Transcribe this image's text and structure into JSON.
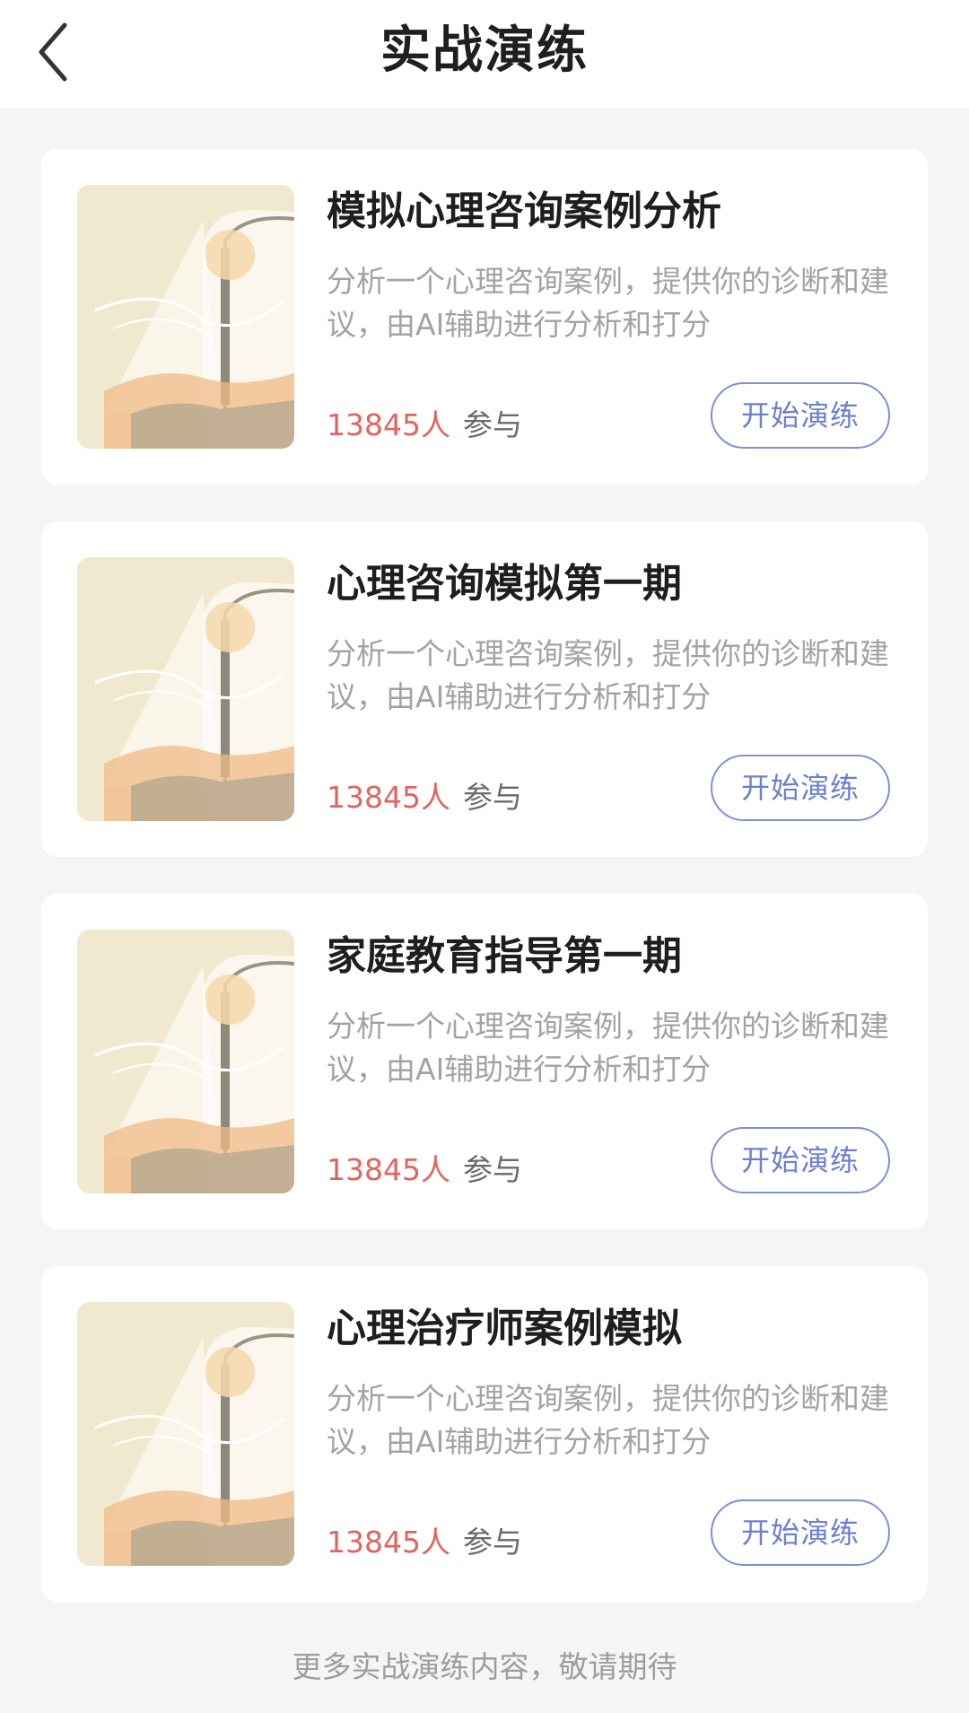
{
  "header": {
    "title": "实战演练",
    "back_icon": "chevron-left-icon"
  },
  "cards": [
    {
      "title": "模拟心理咨询案例分析",
      "description": "分析一个心理咨询案例，提供你的诊断和建议，由AI辅助进行分析和打分",
      "count": "13845人",
      "count_suffix": "参与",
      "button_label": "开始演练"
    },
    {
      "title": "心理咨询模拟第一期",
      "description": "分析一个心理咨询案例，提供你的诊断和建议，由AI辅助进行分析和打分",
      "count": "13845人",
      "count_suffix": "参与",
      "button_label": "开始演练"
    },
    {
      "title": "家庭教育指导第一期",
      "description": "分析一个心理咨询案例，提供你的诊断和建议，由AI辅助进行分析和打分",
      "count": "13845人",
      "count_suffix": "参与",
      "button_label": "开始演练"
    },
    {
      "title": "心理治疗师案例模拟",
      "description": "分析一个心理咨询案例，提供你的诊断和建议，由AI辅助进行分析和打分",
      "count": "13845人",
      "count_suffix": "参与",
      "button_label": "开始演练"
    }
  ],
  "footer": {
    "note": "更多实战演练内容，敬请期待"
  },
  "colors": {
    "accent": "#7f8fd8",
    "count_red": "#e0655f",
    "thumb_bg": "#f1e9cf"
  }
}
